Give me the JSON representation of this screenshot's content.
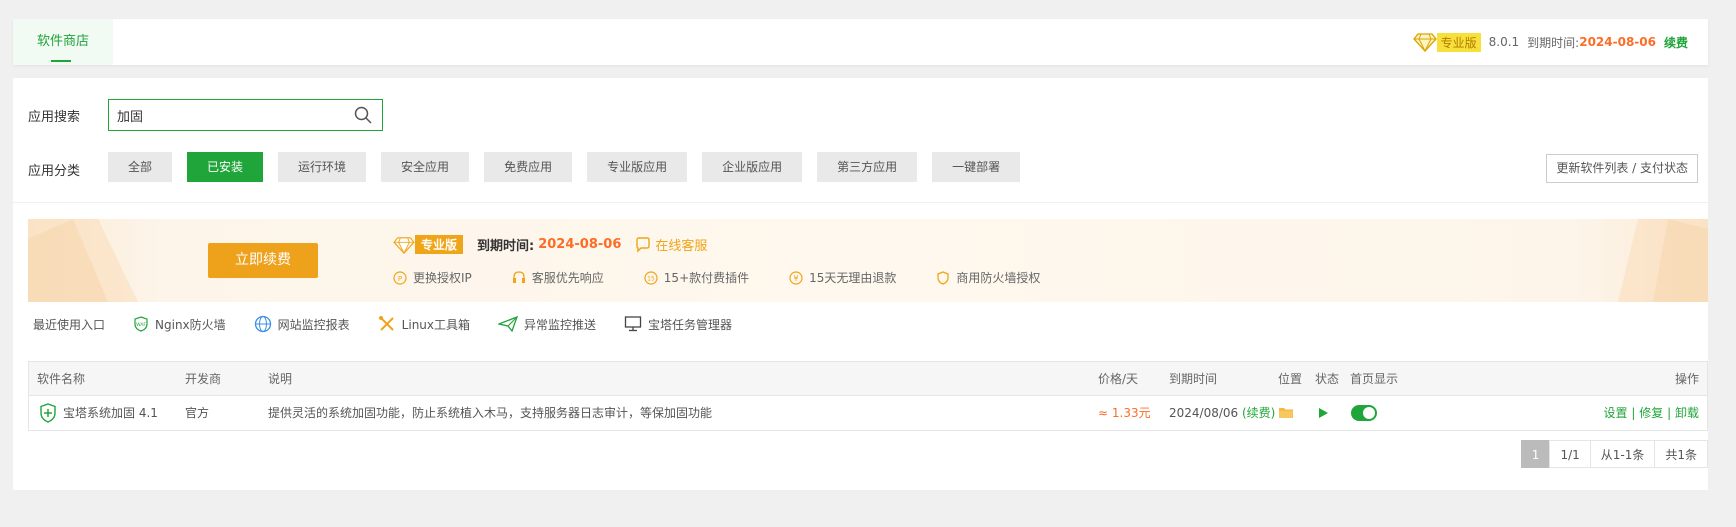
{
  "header": {
    "tab_label": "软件商店",
    "pro_label": "专业版",
    "version": "8.0.1",
    "expire_label": "到期时间:",
    "expire_date": "2024-08-06",
    "renew_label": "续费"
  },
  "search": {
    "label": "应用搜索",
    "value": "加固",
    "placeholder": ""
  },
  "categories": {
    "label": "应用分类",
    "items": [
      "全部",
      "已安装",
      "运行环境",
      "安全应用",
      "免费应用",
      "专业版应用",
      "企业版应用",
      "第三方应用",
      "一键部署"
    ],
    "active_index": 1,
    "update_button": "更新软件列表 / 支付状态"
  },
  "banner": {
    "renew_button": "立即续费",
    "pro_label": "专业版",
    "expire_label": "到期时间:",
    "expire_date": "2024-08-06",
    "customer_service": "在线客服",
    "features": [
      "更换授权IP",
      "客服优先响应",
      "15+款付费插件",
      "15天无理由退款",
      "商用防火墙授权"
    ]
  },
  "recent": {
    "label": "最近使用入口",
    "items": [
      "Nginx防火墙",
      "网站监控报表",
      "Linux工具箱",
      "异常监控推送",
      "宝塔任务管理器"
    ]
  },
  "table": {
    "headers": {
      "name": "软件名称",
      "developer": "开发商",
      "desc": "说明",
      "price": "价格/天",
      "expire": "到期时间",
      "location": "位置",
      "status": "状态",
      "homepage": "首页显示",
      "actions": "操作"
    },
    "rows": [
      {
        "name": "宝塔系统加固 4.1",
        "developer": "官方",
        "desc": "提供灵活的系统加固功能，防止系统植入木马，支持服务器日志审计，等保加固功能",
        "price": "≈ 1.33元",
        "expire": "2024/08/06",
        "renew": "(续费)",
        "action_settings": "设置",
        "action_repair": "修复",
        "action_uninstall": "卸载",
        "sep": "|"
      }
    ]
  },
  "pager": {
    "current": "1",
    "pages": "1/1",
    "range": "从1-1条",
    "total": "共1条"
  },
  "colors": {
    "accent": "#20a53a",
    "warning": "#fc6d26",
    "gold": "#f0a417"
  }
}
